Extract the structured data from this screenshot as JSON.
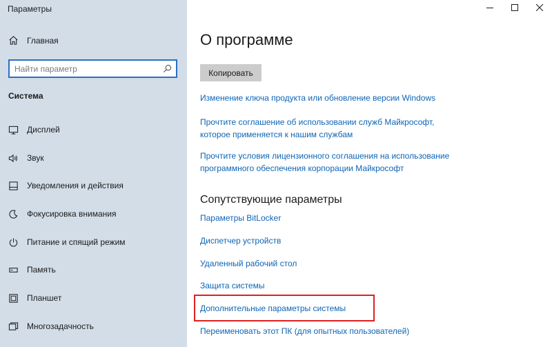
{
  "window": {
    "title": "Параметры",
    "controls": [
      "minimize-icon",
      "maximize-icon",
      "close-icon"
    ]
  },
  "sidebar": {
    "home": {
      "label": "Главная",
      "icon": "home-icon"
    },
    "search": {
      "placeholder": "Найти параметр",
      "icon": "search-icon"
    },
    "section": "Система",
    "items": [
      {
        "label": "Дисплей",
        "icon": "display-icon"
      },
      {
        "label": "Звук",
        "icon": "sound-icon"
      },
      {
        "label": "Уведомления и действия",
        "icon": "notifications-icon"
      },
      {
        "label": "Фокусировка внимания",
        "icon": "focus-assist-icon"
      },
      {
        "label": "Питание и спящий режим",
        "icon": "power-icon"
      },
      {
        "label": "Память",
        "icon": "storage-icon"
      },
      {
        "label": "Планшет",
        "icon": "tablet-icon"
      },
      {
        "label": "Многозадачность",
        "icon": "multitasking-icon"
      }
    ]
  },
  "main": {
    "title": "О программе",
    "copy_button": "Копировать",
    "links": [
      {
        "lines": [
          "Изменение ключа продукта или обновление версии Windows"
        ]
      },
      {
        "lines": [
          "Прочтите соглашение об использовании служб Майкрософт,",
          "которое применяется к нашим службам"
        ]
      },
      {
        "lines": [
          "Прочтите условия лицензионного соглашения на использование",
          "программного обеспечения корпорации Майкрософт"
        ]
      }
    ],
    "related": {
      "heading": "Сопутствующие параметры",
      "links": [
        "Параметры BitLocker",
        "Диспетчер устройств",
        "Удаленный рабочий стол",
        "Защита системы",
        "Дополнительные параметры системы",
        "Переименовать этот ПК (для опытных пользователей)"
      ]
    },
    "highlight_color": "#e01e1e",
    "link_color": "#0d64b5",
    "sidebar_color": "#d2dde8"
  }
}
